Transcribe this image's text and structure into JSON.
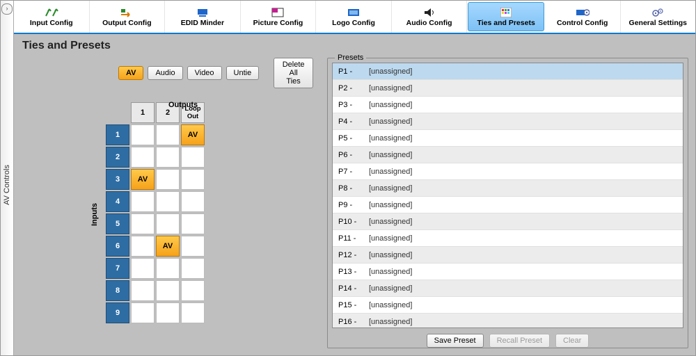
{
  "siderail": {
    "label": "AV Controls"
  },
  "toolbar": {
    "items": [
      {
        "label": "Input Config"
      },
      {
        "label": "Output Config"
      },
      {
        "label": "EDID Minder"
      },
      {
        "label": "Picture Config"
      },
      {
        "label": "Logo Config"
      },
      {
        "label": "Audio Config"
      },
      {
        "label": "Ties and Presets"
      },
      {
        "label": "Control Config"
      },
      {
        "label": "General Settings"
      }
    ],
    "active_index": 6
  },
  "page": {
    "title": "Ties and Presets"
  },
  "tie_buttons": {
    "av": "AV",
    "audio": "Audio",
    "video": "Video",
    "untie": "Untie",
    "delete_all": "Delete All Ties",
    "selected": "av"
  },
  "grid": {
    "outputs_label": "Outputs",
    "inputs_label": "Inputs",
    "output_headers": [
      "1",
      "2",
      "Loop Out"
    ],
    "input_headers": [
      "1",
      "2",
      "3",
      "4",
      "5",
      "6",
      "7",
      "8",
      "9"
    ],
    "ties": [
      {
        "input": 1,
        "output": 3,
        "label": "AV"
      },
      {
        "input": 3,
        "output": 1,
        "label": "AV"
      },
      {
        "input": 6,
        "output": 2,
        "label": "AV"
      }
    ]
  },
  "presets": {
    "legend": "Presets",
    "items": [
      {
        "id": "P1 -",
        "name": "[unassigned]"
      },
      {
        "id": "P2 -",
        "name": "[unassigned]"
      },
      {
        "id": "P3 -",
        "name": "[unassigned]"
      },
      {
        "id": "P4 -",
        "name": "[unassigned]"
      },
      {
        "id": "P5 -",
        "name": "[unassigned]"
      },
      {
        "id": "P6 -",
        "name": "[unassigned]"
      },
      {
        "id": "P7 -",
        "name": "[unassigned]"
      },
      {
        "id": "P8 -",
        "name": "[unassigned]"
      },
      {
        "id": "P9 -",
        "name": "[unassigned]"
      },
      {
        "id": "P10 -",
        "name": "[unassigned]"
      },
      {
        "id": "P11 -",
        "name": "[unassigned]"
      },
      {
        "id": "P12 -",
        "name": "[unassigned]"
      },
      {
        "id": "P13 -",
        "name": "[unassigned]"
      },
      {
        "id": "P14 -",
        "name": "[unassigned]"
      },
      {
        "id": "P15 -",
        "name": "[unassigned]"
      },
      {
        "id": "P16 -",
        "name": "[unassigned]"
      }
    ],
    "selected_index": 0,
    "buttons": {
      "save": "Save Preset",
      "recall": "Recall Preset",
      "clear": "Clear"
    }
  }
}
